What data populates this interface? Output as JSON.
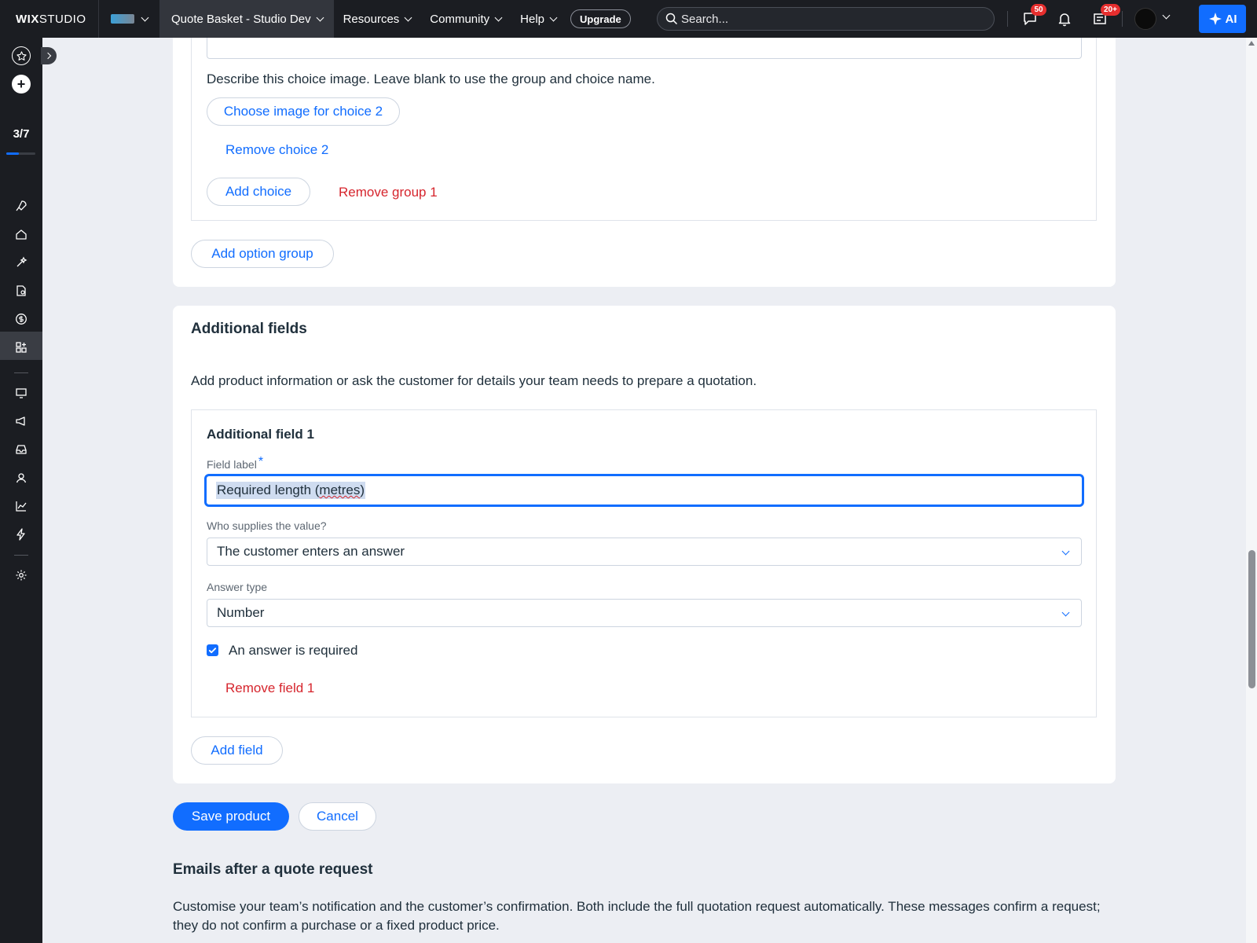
{
  "topbar": {
    "logo_bold": "WIX",
    "logo_rest": "STUDIO",
    "site_name": "Quote Basket - Studio Dev",
    "menu": [
      "Resources",
      "Community",
      "Help"
    ],
    "upgrade": "Upgrade",
    "search_placeholder": "Search...",
    "messages_badge": "50",
    "inbox_badge": "20+",
    "ai_label": "AI"
  },
  "rail": {
    "progress_text": "3/7",
    "progress_fraction": 0.43
  },
  "options_section": {
    "choice_image_hint": "Describe this choice image. Leave blank to use the group and choice name.",
    "choose_image_button": "Choose image for choice 2",
    "remove_choice_link": "Remove choice 2",
    "add_choice_button": "Add choice",
    "remove_group_link": "Remove group 1",
    "add_option_group_button": "Add option group"
  },
  "additional_fields": {
    "title": "Additional fields",
    "description": "Add product information or ask the customer for details your team needs to prepare a quotation.",
    "field": {
      "title": "Additional field 1",
      "label_caption": "Field label",
      "required_mark": "*",
      "label_value_part1": "Required length (",
      "label_value_misspelled": "metres",
      "label_value_part2": ")",
      "supplier_caption": "Who supplies the value?",
      "supplier_value": "The customer enters an answer",
      "answer_type_caption": "Answer type",
      "answer_type_value": "Number",
      "required_checkbox_label": "An answer is required",
      "required_checked": true,
      "remove_field_link": "Remove field 1"
    },
    "add_field_button": "Add field"
  },
  "actions": {
    "save": "Save product",
    "cancel": "Cancel"
  },
  "emails": {
    "title": "Emails after a quote request",
    "description_line1": "Customise your team’s notification and the customer’s confirmation. Both include the full quotation request automatically. These messages confirm a request;",
    "description_line2": "they do not confirm a purchase or a fixed product price."
  },
  "colors": {
    "accent": "#116dff",
    "danger": "#d6252d",
    "topbar": "#1b1d22",
    "page_bg": "#eceef3"
  }
}
